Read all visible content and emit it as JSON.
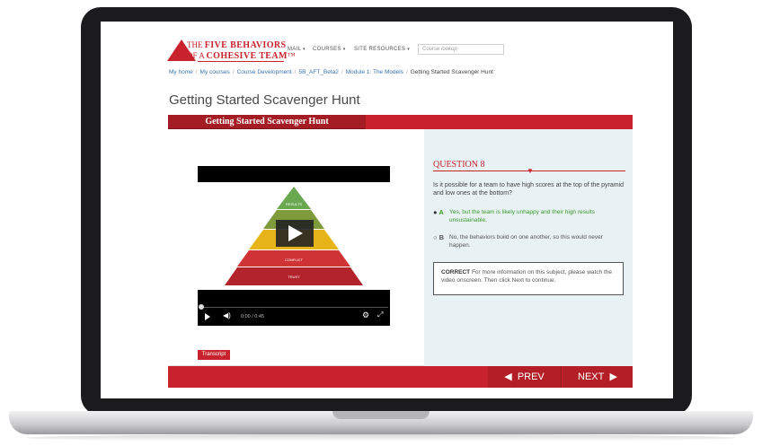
{
  "logo": {
    "line1_small": "THE",
    "line1_big": "FIVE BEHAVIORS",
    "line2_small": "OF A",
    "line2_big": "COHESIVE TEAM",
    "trademark": "™"
  },
  "nav": {
    "items": [
      {
        "label": "MAIL",
        "caret": "▾"
      },
      {
        "label": "COURSES",
        "caret": "▾"
      },
      {
        "label": "SITE RESOURCES",
        "caret": "▾"
      }
    ],
    "search_placeholder": "Course lookup"
  },
  "breadcrumb": {
    "items": [
      "My home",
      "My courses",
      "Course Development",
      "5B_AFT_Beta2",
      "Module 1: The Models"
    ],
    "current": "Getting Started Scavenger Hunt",
    "separator": "/"
  },
  "page_title": "Getting Started Scavenger Hunt",
  "banner_title": "Getting Started Scavenger Hunt",
  "video": {
    "pyramid_levels": [
      "RESULTS",
      "",
      "",
      "CONFLICT",
      "TRUST"
    ],
    "time": "0:00 / 0:45",
    "transcript_label": "Transcript"
  },
  "question": {
    "title": "QUESTION 8",
    "text": "Is it possible for a team to have high scores at the top of the pyramid and low ones at the bottom?",
    "options": [
      {
        "letter": "A",
        "text": "Yes, but the team is likely unhappy and their high results unsustainable.",
        "selected": true
      },
      {
        "letter": "B",
        "text": "No, the behaviors build on one another, so this would never happen.",
        "selected": false
      }
    ],
    "feedback_label": "CORRECT",
    "feedback_text": "For more information on this subject, please watch the video onscreen. Then click Next to continue."
  },
  "footer": {
    "prev_label": "PREV",
    "next_label": "NEXT"
  },
  "colors": {
    "brand_red": "#c8232c",
    "correct_green": "#3a9a2a",
    "panel_bg": "#e8f1f4"
  }
}
